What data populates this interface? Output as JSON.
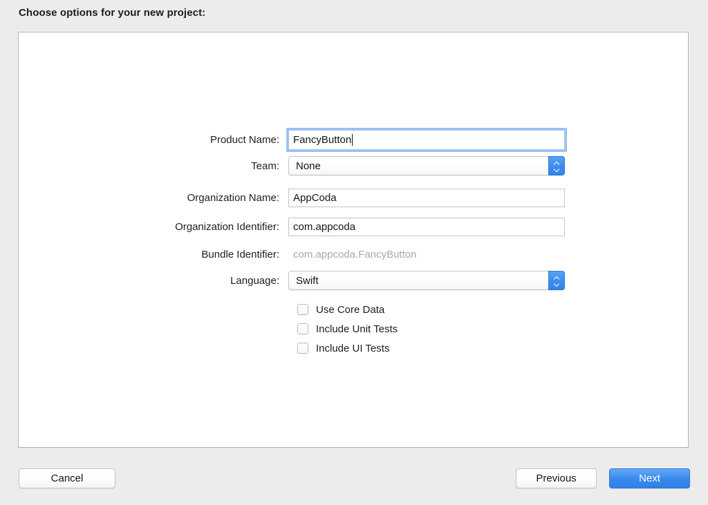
{
  "heading": "Choose options for your new project:",
  "form": {
    "fields": [
      {
        "key": "product_name",
        "label": "Product Name:",
        "value": "FancyButton",
        "type": "text",
        "focused": true
      },
      {
        "key": "team",
        "label": "Team:",
        "value": "None",
        "type": "popup"
      },
      {
        "key": "organization_name",
        "label": "Organization Name:",
        "value": "AppCoda",
        "type": "text",
        "focused": false
      },
      {
        "key": "organization_identifier",
        "label": "Organization Identifier:",
        "value": "com.appcoda",
        "type": "text",
        "focused": false
      },
      {
        "key": "bundle_identifier",
        "label": "Bundle Identifier:",
        "value": "com.appcoda.FancyButton",
        "type": "static"
      },
      {
        "key": "language",
        "label": "Language:",
        "value": "Swift",
        "type": "popup"
      }
    ],
    "checkboxes": [
      {
        "key": "use_core_data",
        "label": "Use Core Data",
        "checked": false
      },
      {
        "key": "include_unit_tests",
        "label": "Include Unit Tests",
        "checked": false
      },
      {
        "key": "include_ui_tests",
        "label": "Include UI Tests",
        "checked": false
      }
    ]
  },
  "buttons": {
    "cancel": "Cancel",
    "previous": "Previous",
    "next": "Next"
  },
  "colors": {
    "window_background": "#ececec",
    "panel_background": "#ffffff",
    "panel_border": "#b6b6b6",
    "accent_blue": "#3b8bed",
    "focus_ring": "#78adeb",
    "disabled_text": "#a8a8a8",
    "text": "#1d1d1d"
  },
  "icons": {
    "stepper_up": "chevron-up-icon",
    "stepper_down": "chevron-down-icon"
  }
}
